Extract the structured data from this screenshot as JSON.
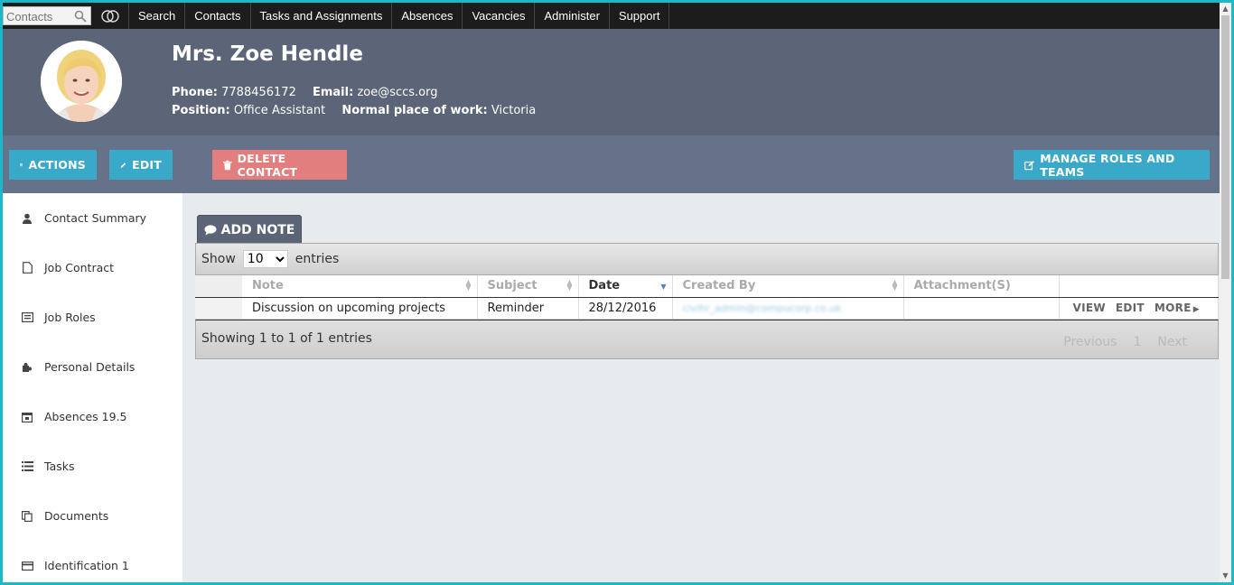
{
  "nav": {
    "search_placeholder": "Contacts",
    "items": [
      "Search",
      "Contacts",
      "Tasks and Assignments",
      "Absences",
      "Vacancies",
      "Administer",
      "Support"
    ]
  },
  "contact": {
    "name": "Mrs. Zoe Hendle",
    "phone_label": "Phone:",
    "phone": "7788456172",
    "email_label": "Email:",
    "email": "zoe@sccs.org",
    "position_label": "Position:",
    "position": "Office Assistant",
    "workplace_label": "Normal place of work:",
    "workplace": "Victoria"
  },
  "actions": {
    "actions_label": "ACTIONS",
    "edit_label": "EDIT",
    "delete_label": "DELETE CONTACT",
    "manage_label": "MANAGE ROLES AND TEAMS"
  },
  "sidebar": {
    "items": [
      {
        "label": "Contact Summary"
      },
      {
        "label": "Job Contract"
      },
      {
        "label": "Job Roles"
      },
      {
        "label": "Personal Details"
      },
      {
        "label": "Absences 19.5"
      },
      {
        "label": "Tasks"
      },
      {
        "label": "Documents"
      },
      {
        "label": "Identification 1"
      }
    ]
  },
  "notes": {
    "add_note_label": "ADD NOTE",
    "show_label": "Show",
    "page_size": "10",
    "entries_label": "entries",
    "columns": [
      "Note",
      "Subject",
      "Date",
      "Created By",
      "Attachment(S)"
    ],
    "rows": [
      {
        "note": "Discussion on upcoming projects",
        "subject": "Reminder",
        "date": "28/12/2016",
        "created_by": "civihr_admin@compucorp.co.uk",
        "attachments": "",
        "view": "VIEW",
        "edit": "EDIT",
        "more": "MORE"
      }
    ],
    "info": "Showing 1 to 1 of 1 entries",
    "previous": "Previous",
    "page": "1",
    "next": "Next"
  },
  "colors": {
    "header": "#5b6577",
    "actionbar": "#66718a",
    "button_blue": "#3aa9c9",
    "button_red": "#e37e7e",
    "frame": "#1bb8c9"
  }
}
